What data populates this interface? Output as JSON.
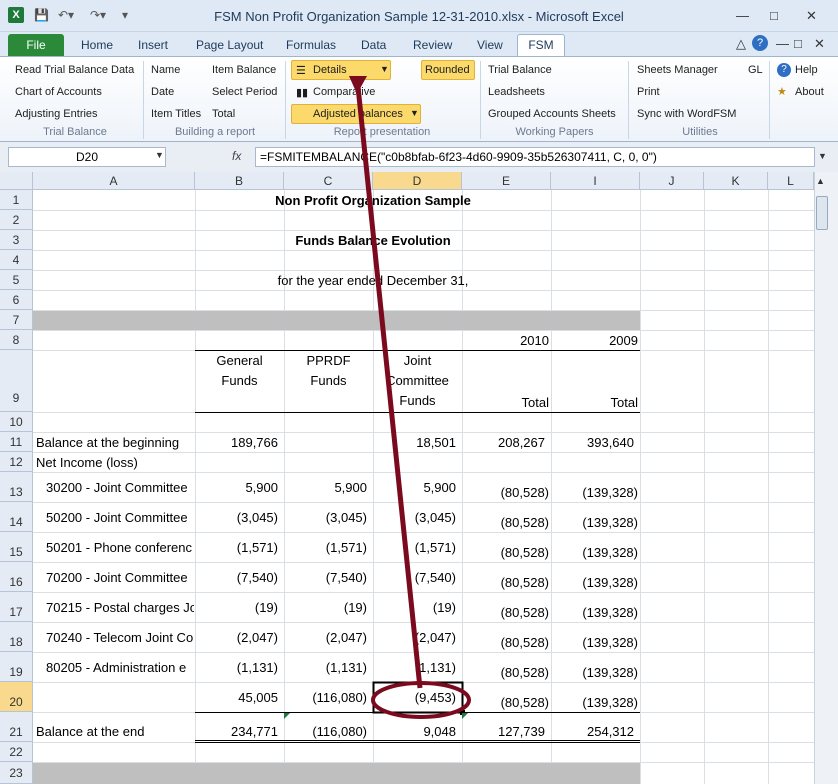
{
  "window": {
    "title": "FSM Non Profit Organization Sample 12-31-2010.xlsx  -  Microsoft Excel"
  },
  "tabs": [
    "File",
    "Home",
    "Insert",
    "Page Layout",
    "Formulas",
    "Data",
    "Review",
    "View",
    "FSM"
  ],
  "ribbon": {
    "trial_balance": {
      "items": [
        "Read Trial Balance Data",
        "Chart of Accounts",
        "Adjusting Entries"
      ],
      "label": "Trial Balance"
    },
    "building": {
      "items": [
        "Name",
        "Date",
        "Item Titles",
        "Item Balance",
        "Select Period",
        "Total"
      ],
      "label": "Building a report"
    },
    "presentation": {
      "details": "Details",
      "rounded": "Rounded",
      "comparative": "Comparative",
      "adjusted": "Adjusted balances",
      "label": "Report presentation"
    },
    "working": {
      "items": [
        "Trial Balance",
        "Leadsheets",
        "Grouped Accounts Sheets"
      ],
      "label": "Working Papers"
    },
    "utilities": {
      "items": [
        "Sheets Manager",
        "GL",
        "Print",
        "Sync with WordFSM"
      ],
      "label": "Utilities"
    },
    "help": {
      "help": "Help",
      "about": "About"
    }
  },
  "formula_bar": {
    "name_box": "D20",
    "fx": "fx",
    "formula": "=FSMITEMBALANCE(\"c0b8bfab-6f23-4d60-9909-35b526307411, C, 0, 0\")"
  },
  "columns": [
    "A",
    "B",
    "C",
    "D",
    "E",
    "I",
    "J",
    "K",
    "L"
  ],
  "rows": [
    "1",
    "2",
    "3",
    "4",
    "5",
    "6",
    "7",
    "8",
    "9",
    "10",
    "11",
    "12",
    "13",
    "14",
    "15",
    "16",
    "17",
    "18",
    "19",
    "20",
    "21",
    "22",
    "23"
  ],
  "sheet": {
    "title": "Non Profit Organization Sample",
    "subtitle": "Funds Balance Evolution",
    "period": "for the year ended December 31,",
    "year1": "2010",
    "year2": "2009",
    "h_b": [
      "General",
      "Funds"
    ],
    "h_c": [
      "PPRDF",
      "Funds"
    ],
    "h_d": [
      "Joint",
      "Committee",
      "Funds"
    ],
    "h_e": "Total",
    "h_i": "Total",
    "r11": [
      "Balance at the beginning",
      "189,766",
      "",
      "18,501",
      "208,267",
      "393,640"
    ],
    "r12": "Net Income (loss)",
    "lines": [
      [
        "30200 - Joint Committee",
        "5,900",
        "5,900",
        "5,900",
        "(80,528)",
        "(139,328)"
      ],
      [
        "50200 - Joint Committee",
        "(3,045)",
        "(3,045)",
        "(3,045)",
        "(80,528)",
        "(139,328)"
      ],
      [
        "50201 - Phone conferenc",
        "(1,571)",
        "(1,571)",
        "(1,571)",
        "(80,528)",
        "(139,328)"
      ],
      [
        "70200 - Joint Committee",
        "(7,540)",
        "(7,540)",
        "(7,540)",
        "(80,528)",
        "(139,328)"
      ],
      [
        "70215 - Postal charges Jo",
        "(19)",
        "(19)",
        "(19)",
        "(80,528)",
        "(139,328)"
      ],
      [
        "70240 - Telecom Joint Co",
        "(2,047)",
        "(2,047)",
        "(2,047)",
        "(80,528)",
        "(139,328)"
      ],
      [
        "80205 - Administration e",
        "(1,131)",
        "(1,131)",
        "(1,131)",
        "(80,528)",
        "(139,328)"
      ]
    ],
    "r20": [
      "",
      "45,005",
      "(116,080)",
      "(9,453)",
      "(80,528)",
      "(139,328)"
    ],
    "r21": [
      "Balance at the end",
      "234,771",
      "(116,080)",
      "9,048",
      "127,739",
      "254,312"
    ]
  },
  "colors": {
    "accent": "#7b0a1e",
    "file_tab": "#2a8a3a",
    "highlight": "#fcd96b"
  }
}
